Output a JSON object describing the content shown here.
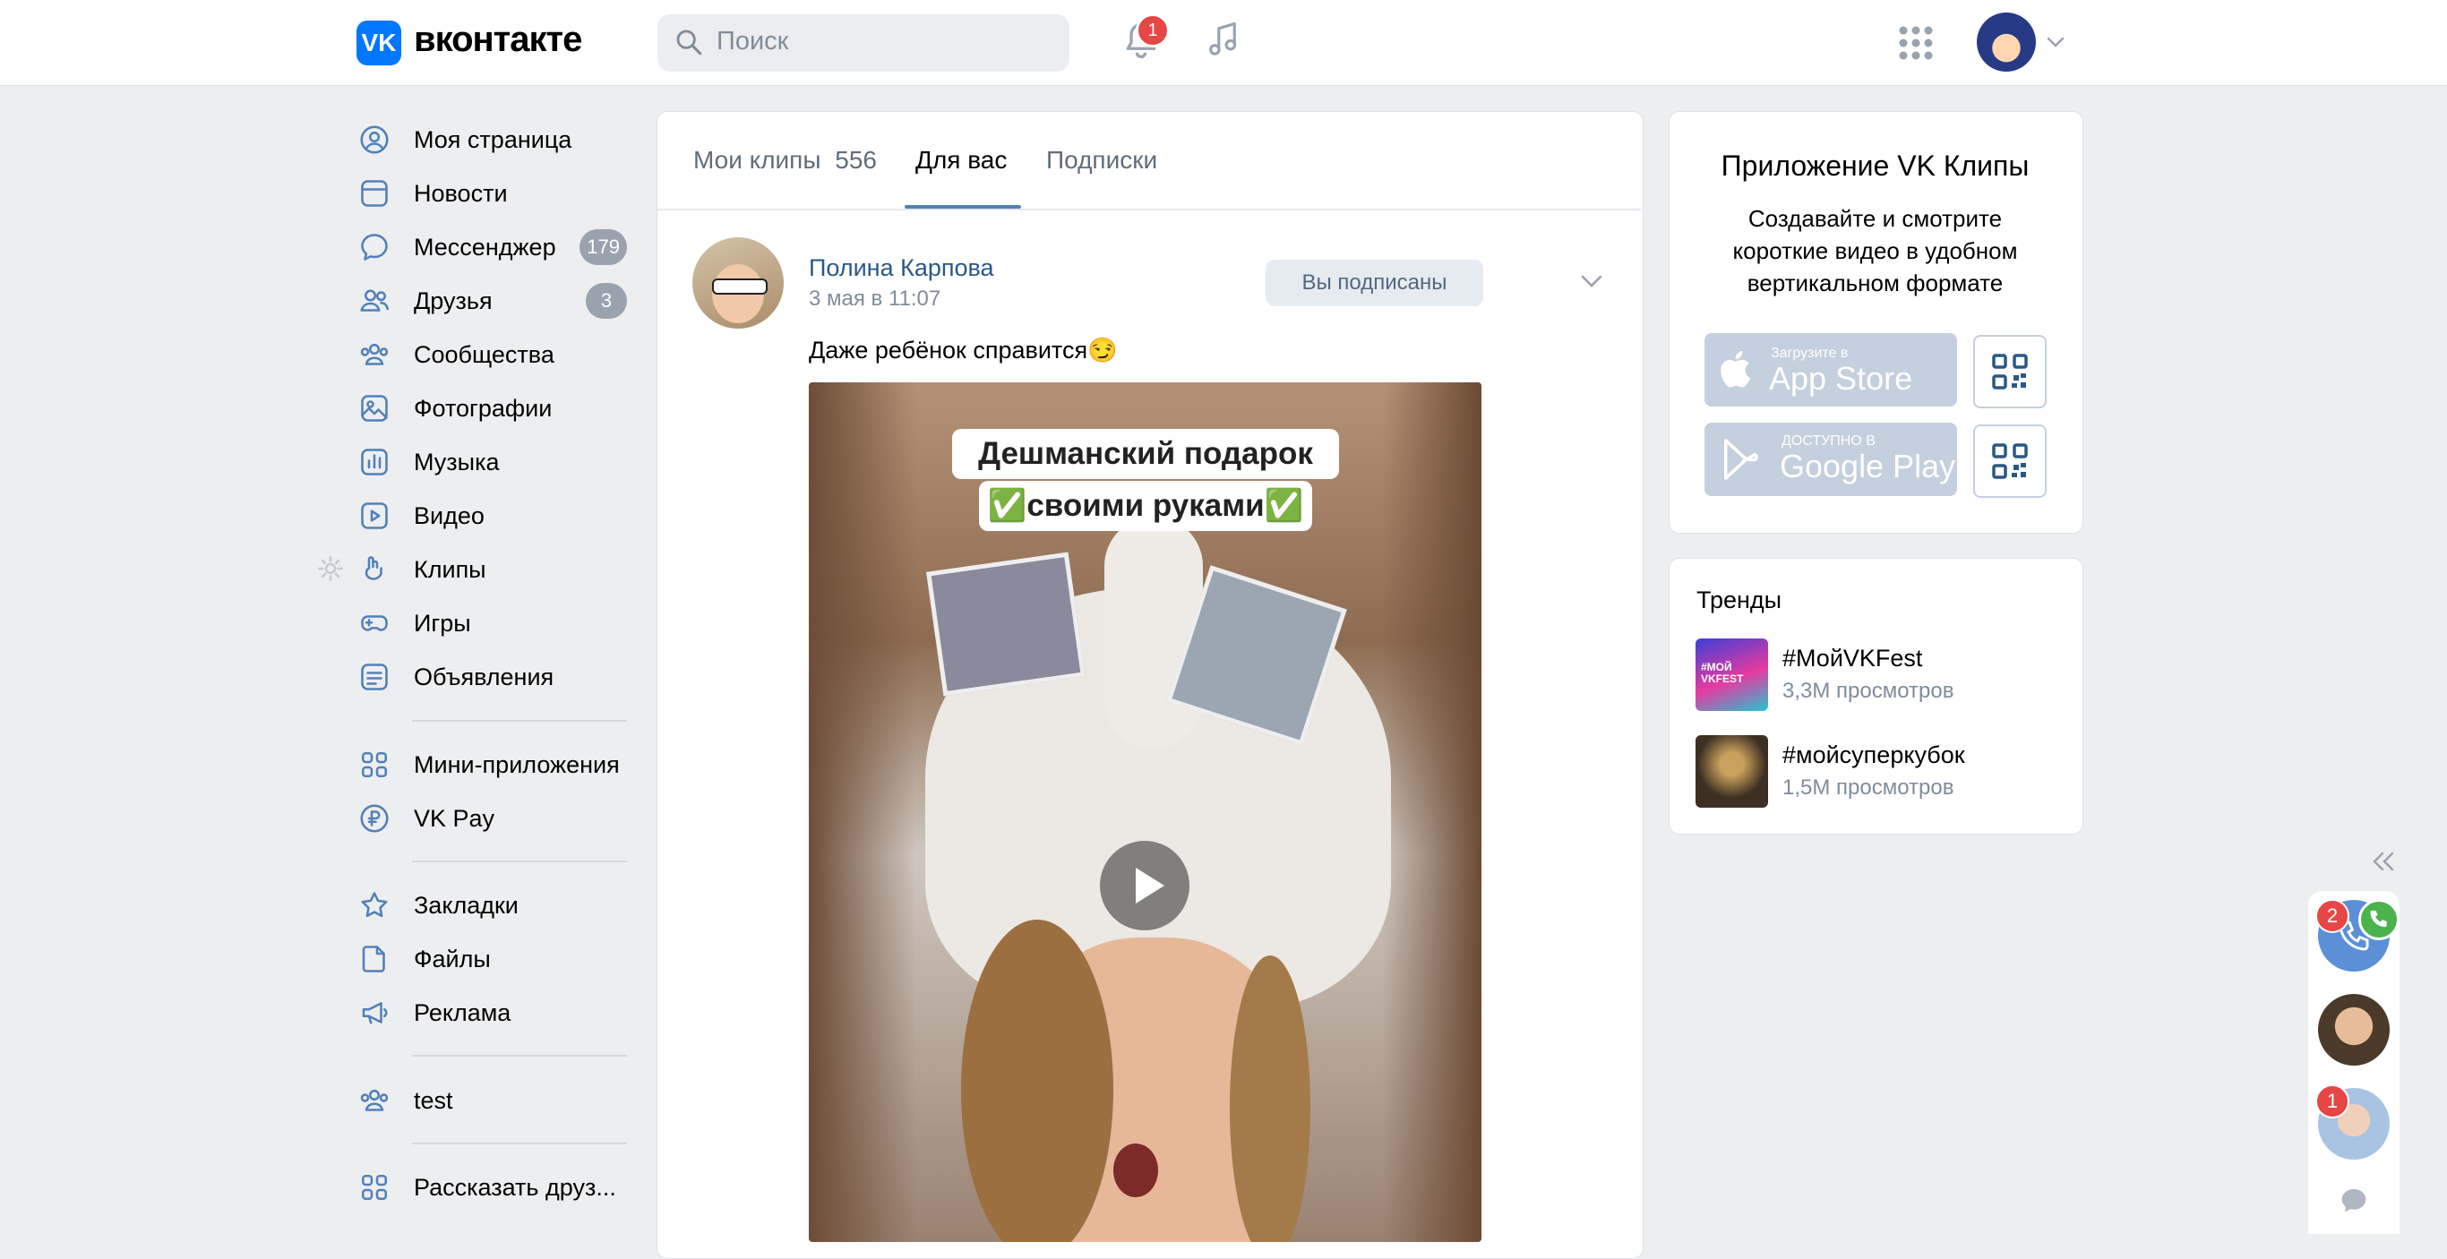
{
  "header": {
    "logo_text": "вконтакте",
    "search_placeholder": "Поиск",
    "notifications_count": "1"
  },
  "sidebar": {
    "items": [
      {
        "label": "Моя страница",
        "icon": "user-circle-icon"
      },
      {
        "label": "Новости",
        "icon": "news-icon"
      },
      {
        "label": "Мессенджер",
        "icon": "message-icon",
        "count": "179"
      },
      {
        "label": "Друзья",
        "icon": "friends-icon",
        "count": "3"
      },
      {
        "label": "Сообщества",
        "icon": "communities-icon"
      },
      {
        "label": "Фотографии",
        "icon": "photo-icon"
      },
      {
        "label": "Музыка",
        "icon": "music-icon"
      },
      {
        "label": "Видео",
        "icon": "video-icon"
      },
      {
        "label": "Клипы",
        "icon": "clips-icon"
      },
      {
        "label": "Игры",
        "icon": "gamepad-icon"
      },
      {
        "label": "Объявления",
        "icon": "classifieds-icon"
      },
      {
        "label": "Мини-приложения",
        "icon": "apps-icon"
      },
      {
        "label": "VK Pay",
        "icon": "vkpay-icon"
      },
      {
        "label": "Закладки",
        "icon": "star-icon"
      },
      {
        "label": "Файлы",
        "icon": "file-icon"
      },
      {
        "label": "Реклама",
        "icon": "megaphone-icon"
      },
      {
        "label": "test",
        "icon": "group-icon"
      },
      {
        "label": "Рассказать друз...",
        "icon": "apps-icon"
      }
    ]
  },
  "tabs": {
    "my_clips": "Мои клипы",
    "my_clips_count": "556",
    "for_you": "Для вас",
    "subscriptions": "Подписки"
  },
  "post": {
    "author": "Полина Карпова",
    "date": "3 мая в 11:07",
    "follow_label": "Вы подписаны",
    "text": "Даже ребёнок справится😏",
    "video_caption_line1": "Дешманский подарок",
    "video_caption_line2": "✅своими руками✅"
  },
  "app_promo": {
    "title": "Приложение VK Клипы",
    "description": "Создавайте и смотрите короткие видео в удобном вертикальном формате",
    "appstore_small": "Загрузите в",
    "appstore_big": "App Store",
    "googleplay_small": "ДОСТУПНО В",
    "googleplay_big": "Google Play"
  },
  "trends": {
    "title": "Тренды",
    "items": [
      {
        "tag": "#МойVKFest",
        "views": "3,3M просмотров",
        "thumb_text": "#МОЙ VKFEST"
      },
      {
        "tag": "#мойсуперкубок",
        "views": "1,5M просмотров"
      }
    ]
  },
  "chat_rail": {
    "call_badge": "2",
    "contact_badge": "1"
  },
  "colors": {
    "accent": "#0077ff",
    "link": "#2a5885",
    "badge_red": "#e64646"
  }
}
